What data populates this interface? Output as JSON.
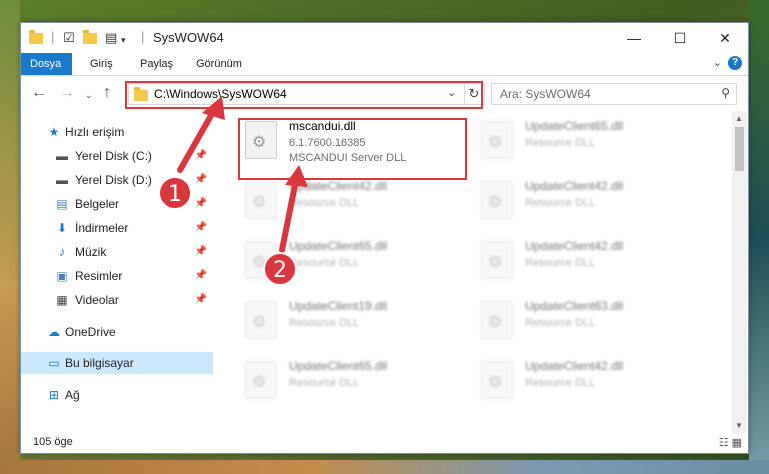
{
  "title": "SysWOW64",
  "title_bar_icons": [
    "folder-icon",
    "properties-icon",
    "new-folder-icon",
    "undo-icon",
    "customize-dropdown"
  ],
  "window_buttons": {
    "minimize": "—",
    "maximize": "☐",
    "close": "✕"
  },
  "ribbon": {
    "tabs": [
      "Dosya",
      "Giriş",
      "Paylaş",
      "Görünüm"
    ],
    "active_tab": "Dosya",
    "help": "?"
  },
  "address_bar": {
    "path": "C:\\Windows\\SysWOW64"
  },
  "search": {
    "placeholder": "Ara: SysWOW64"
  },
  "nav_pane": {
    "items": [
      {
        "label": "Hızlı erişim",
        "icon": "star-icon",
        "pinned": false
      },
      {
        "label": "Yerel Disk (C:)",
        "icon": "drive-icon",
        "pinned": true
      },
      {
        "label": "Yerel Disk (D:)",
        "icon": "drive-icon",
        "pinned": true
      },
      {
        "label": "Belgeler",
        "icon": "documents-icon",
        "pinned": true
      },
      {
        "label": "İndirmeler",
        "icon": "downloads-icon",
        "pinned": true
      },
      {
        "label": "Müzik",
        "icon": "music-icon",
        "pinned": true
      },
      {
        "label": "Resimler",
        "icon": "pictures-icon",
        "pinned": true
      },
      {
        "label": "Videolar",
        "icon": "videos-icon",
        "pinned": true
      },
      {
        "label": "OneDrive",
        "icon": "cloud-icon",
        "pinned": false
      },
      {
        "label": "Bu bilgisayar",
        "icon": "computer-icon",
        "pinned": false,
        "selected": true
      },
      {
        "label": "Ağ",
        "icon": "network-icon",
        "pinned": false
      }
    ]
  },
  "files": [
    {
      "name": "mscandui.dll",
      "line1": "6.1.7600.16385",
      "line2": "MSCANDUI Server DLL",
      "highlighted": true
    },
    {
      "name": "UpdateClient65.dll",
      "line1": "Resource DLL",
      "line2": ""
    },
    {
      "name": "UpdateClient42.dll",
      "line1": "Resource DLL",
      "line2": ""
    },
    {
      "name": "UpdateClient42.dll",
      "line1": "Resource DLL",
      "line2": ""
    },
    {
      "name": "UpdateClient65.dll",
      "line1": "Resource DLL",
      "line2": ""
    },
    {
      "name": "UpdateClient42.dll",
      "line1": "Resource DLL",
      "line2": ""
    },
    {
      "name": "UpdateClient19.dll",
      "line1": "Resource DLL",
      "line2": ""
    },
    {
      "name": "UpdateClient63.dll",
      "line1": "Resource DLL",
      "line2": ""
    },
    {
      "name": "UpdateClient65.dll",
      "line1": "Resource DLL",
      "line2": ""
    },
    {
      "name": "UpdateClient42.dll",
      "line1": "Resource DLL",
      "line2": ""
    }
  ],
  "status": {
    "item_count": "105 öge"
  },
  "markers": [
    "1",
    "2"
  ],
  "colors": {
    "accent": "#1979ca",
    "highlight": "#d9363e",
    "selected": "#cce8ff"
  }
}
